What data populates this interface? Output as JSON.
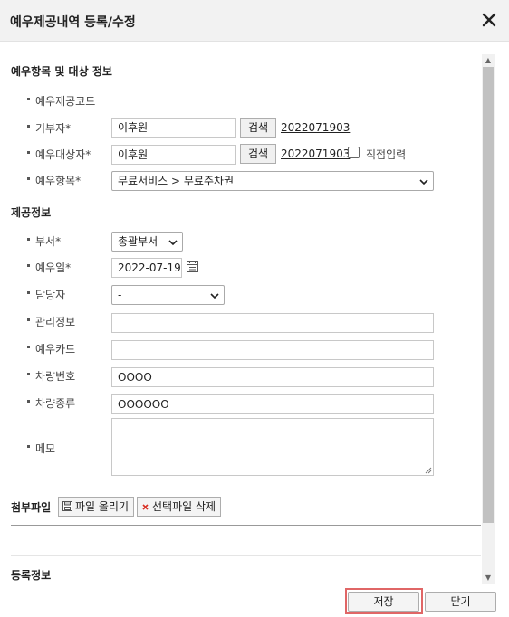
{
  "dialog": {
    "title": "예우제공내역 등록/수정",
    "close_icon": "close-icon"
  },
  "section1": {
    "title": "예우항목 및 대상 정보",
    "code_label": "예우제공코드",
    "donor_label": "기부자*",
    "donor_value": "이후원",
    "donor_search": "검색",
    "donor_link": "2022071903",
    "target_label": "예우대상자*",
    "target_value": "이후원",
    "target_search": "검색",
    "target_link": "2022071903",
    "direct_input_label": "직접입력",
    "item_label": "예우항목*",
    "item_value": "무료서비스 > 무료주차권"
  },
  "section2": {
    "title": "제공정보",
    "dept_label": "부서*",
    "dept_value": "총괄부서",
    "date_label": "예우일*",
    "date_value": "2022-07-19",
    "manager_label": "담당자",
    "manager_value": "-",
    "mgmt_label": "관리정보",
    "mgmt_value": "",
    "card_label": "예우카드",
    "card_value": "",
    "car_no_label": "차량번호",
    "car_no_value": "OOOO",
    "car_type_label": "차량종류",
    "car_type_value": "OOOOOO",
    "memo_label": "메모",
    "memo_value": ""
  },
  "attachments": {
    "title": "첨부파일",
    "upload_label": "파일 올리기",
    "delete_label": "선택파일 삭제"
  },
  "section3": {
    "title": "등록정보"
  },
  "footer": {
    "save_label": "저장",
    "close_label": "닫기"
  },
  "colors": {
    "highlight": "#e06666",
    "delete_x": "#d93025"
  }
}
